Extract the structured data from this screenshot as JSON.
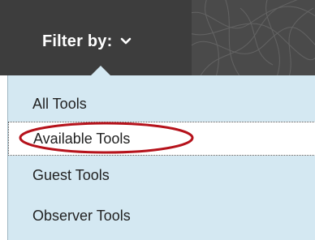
{
  "filter": {
    "label": "Filter by:",
    "chevron_icon": "chevron-down-icon"
  },
  "menu": {
    "items": [
      {
        "label": "All Tools",
        "selected": false
      },
      {
        "label": "Available Tools",
        "selected": true
      },
      {
        "label": "Guest Tools",
        "selected": false
      },
      {
        "label": "Observer Tools",
        "selected": false
      }
    ]
  },
  "colors": {
    "header_bg": "#3d3d3d",
    "menu_bg": "#d4e8f2",
    "highlight_ring": "#b5121b"
  }
}
